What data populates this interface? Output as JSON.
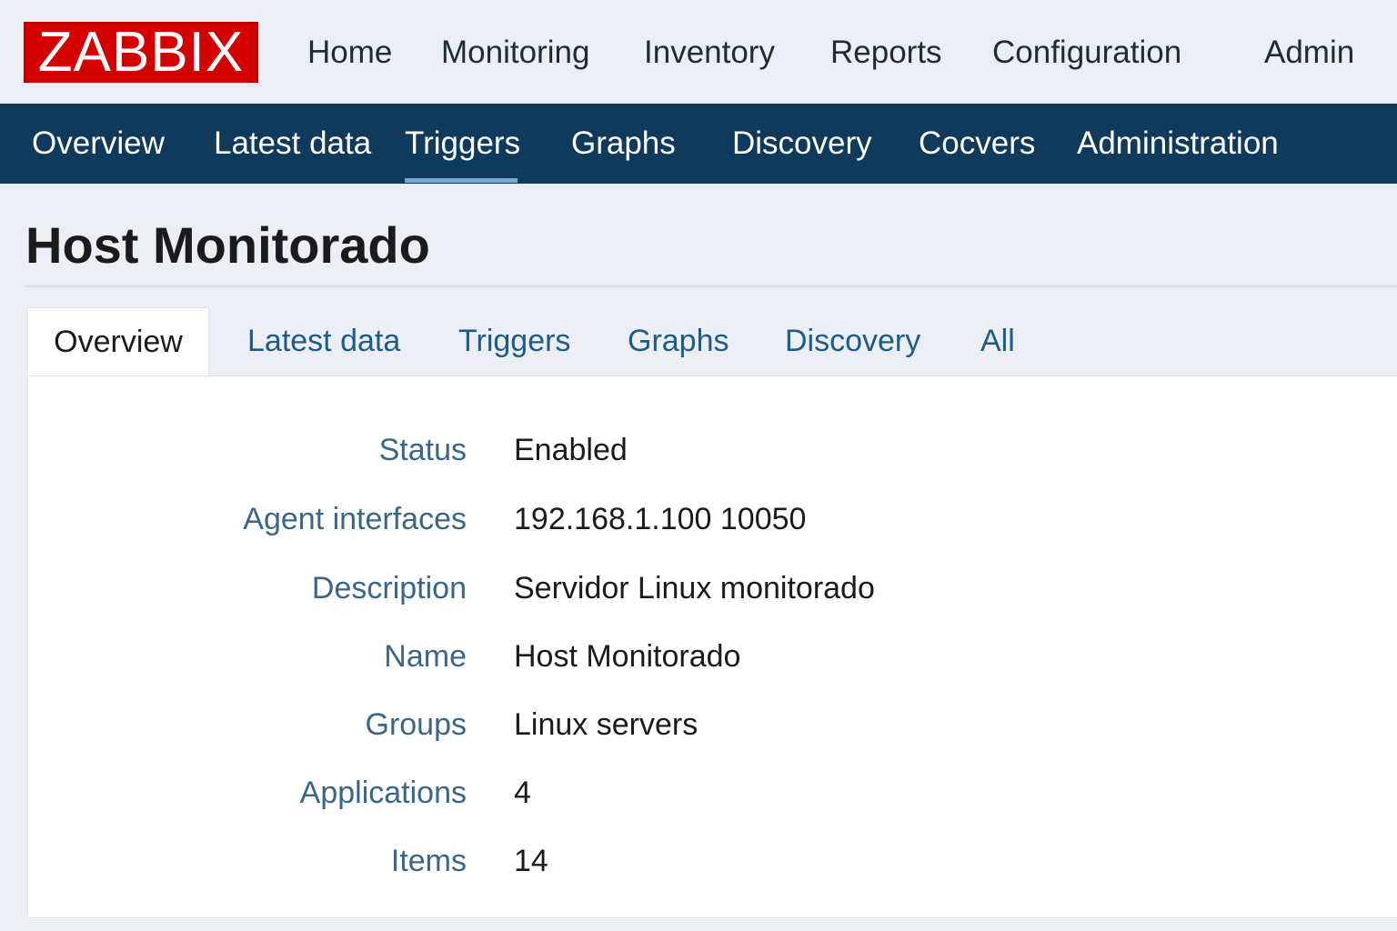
{
  "header": {
    "logo_text": "ZABBIX",
    "menu": [
      "Home",
      "Monitoring",
      "Inventory",
      "Reports",
      "Configuration",
      "Admin"
    ]
  },
  "sub_nav": {
    "items": [
      "Overview",
      "Latest data",
      "Triggers",
      "Graphs",
      "Discovery",
      "Cocvers",
      "Administration"
    ],
    "active": "Triggers"
  },
  "page": {
    "title": "Host Monitorado"
  },
  "tabs": {
    "items": [
      "Overview",
      "Latest data",
      "Triggers",
      "Graphs",
      "Discovery",
      "All"
    ],
    "active": "Overview"
  },
  "details": [
    {
      "label": "Status",
      "value": "Enabled"
    },
    {
      "label": "Agent interfaces",
      "value": "192.168.1.100 10050"
    },
    {
      "label": "Description",
      "value": "Servidor Linux monitorado"
    },
    {
      "label": "Name",
      "value": "Host Monitorado"
    },
    {
      "label": "Groups",
      "value": "Linux servers"
    },
    {
      "label": "Applications",
      "value": "4"
    },
    {
      "label": "Items",
      "value": "14"
    }
  ],
  "colors": {
    "logo_red": "#d40000",
    "nav_blue": "#0f3a5b",
    "link_blue": "#1f5b87",
    "label_blue": "#3a6688",
    "active_underline": "#78a8d4"
  }
}
